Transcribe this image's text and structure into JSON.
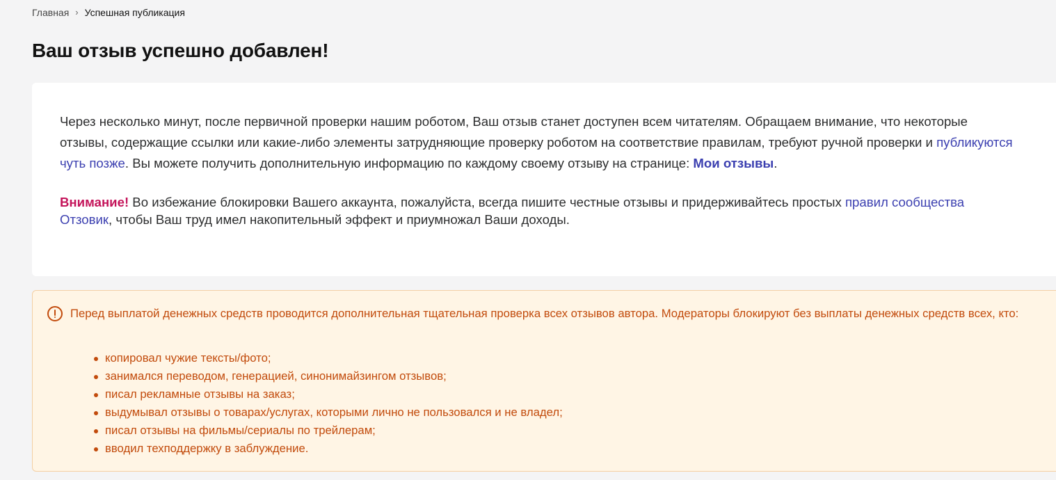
{
  "breadcrumb": {
    "home": "Главная",
    "separator": "›",
    "current": "Успешная публикация"
  },
  "title": "Ваш отзыв успешно добавлен!",
  "info": {
    "p1_text1": "Через несколько минут, после первичной проверки нашим роботом, Ваш отзыв станет доступен всем читателям. Обращаем внимание, что некоторые отзывы, содержащие ссылки или какие-либо элементы затрудняющие проверку роботом на соответствие правилам, требуют ручной проверки и ",
    "p1_link": "публикуются чуть позже",
    "p1_text2": ". Вы можете получить дополнительную информацию по каждому своему отзыву на странице: ",
    "my_reviews_link": "Мои отзывы",
    "p1_end": ".",
    "attention_label": "Внимание!",
    "p2_text1": " Во избежание блокировки Вашего аккаунта, пожалуйста, всегда пишите честные отзывы и придерживайтесь простых ",
    "rules_link": "правил сообщества Отзовик",
    "p2_text2": ", чтобы Ваш труд имел накопительный эффект и приумножал Ваши доходы."
  },
  "notice": {
    "icon": "exclamation-circle-icon",
    "text": "Перед выплатой денежных средств проводится дополнительная тщательная проверка всех отзывов автора. Модераторы блокируют без выплаты денежных средств всех, кто:",
    "items": [
      "копировал чужие тексты/фото;",
      "занимался переводом, генерацией, синонимайзингом отзывов;",
      "писал рекламные отзывы на заказ;",
      "выдумывал отзывы о товарах/услугах, которыми лично не пользовался и не владел;",
      "писал отзывы на фильмы/сериалы по трейлерам;",
      "вводил техподдержку в заблуждение."
    ]
  },
  "colors": {
    "link": "#3b3fb0",
    "attention": "#c4145a",
    "notice_text": "#c24b0c",
    "notice_bg": "#fff5e5"
  }
}
